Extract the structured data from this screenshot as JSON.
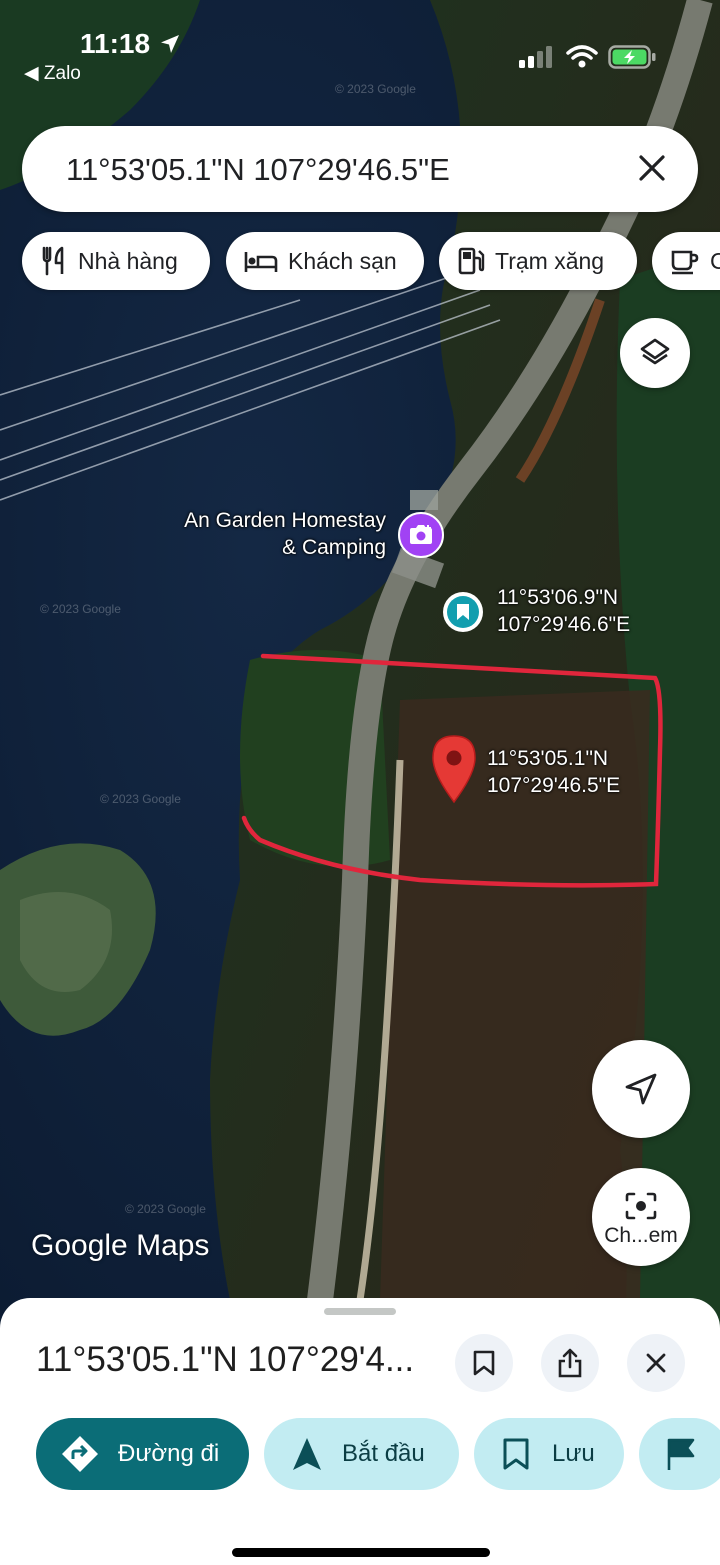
{
  "status_bar": {
    "time": "11:18",
    "back_app": "◀ Zalo"
  },
  "search": {
    "query": "11°53'05.1\"N 107°29'46.5\"E"
  },
  "chips": [
    {
      "label": "Nhà hàng",
      "icon": "fork-knife-icon"
    },
    {
      "label": "Khách sạn",
      "icon": "bed-icon"
    },
    {
      "label": "Trạm xăng",
      "icon": "fuel-icon"
    },
    {
      "label": "C",
      "icon": "coffee-icon"
    }
  ],
  "map": {
    "place_name_line1": "An Garden Homestay",
    "place_name_line2": "& Camping",
    "saved_pin_line1": "11°53'06.9\"N",
    "saved_pin_line2": "107°29'46.6\"E",
    "dropped_pin_line1": "11°53'05.1\"N",
    "dropped_pin_line2": "107°29'46.5\"E",
    "watermark": "Google Maps",
    "tile_credit": "© 2023 Google"
  },
  "lens_button": {
    "label": "Ch...em"
  },
  "sheet": {
    "title": "11°53'05.1\"N 107°29'4...",
    "buttons": [
      {
        "label": "Đường đi",
        "style": "primary"
      },
      {
        "label": "Bắt đầu",
        "style": "tonal"
      },
      {
        "label": "Lưu",
        "style": "tonal"
      }
    ]
  },
  "colors": {
    "primary_button": "#0b6d77",
    "tonal_button": "#c2ecf2",
    "pin_red": "#e53935",
    "saved_pin": "#129eaf",
    "camera_pin": "#a142f4",
    "annotation_red": "#e0263c"
  }
}
